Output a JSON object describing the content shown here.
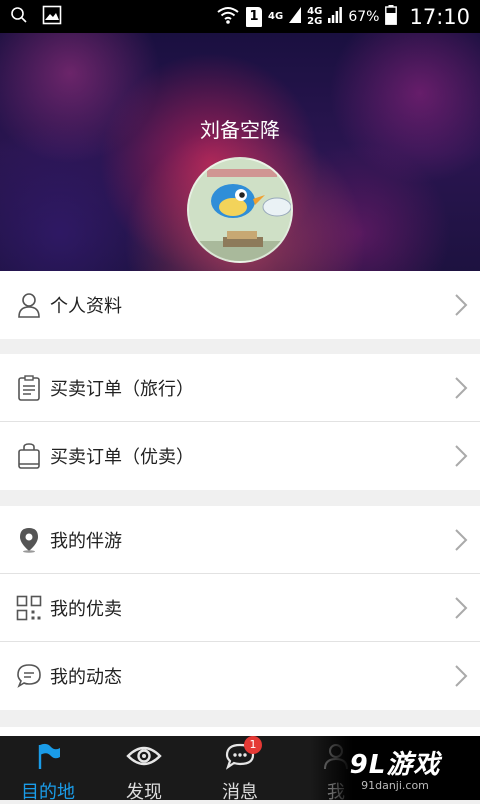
{
  "status_bar": {
    "network_a": "4G",
    "network_b_top": "4G",
    "network_b_bottom": "2G",
    "sim": "1",
    "battery": "67%",
    "time": "17:10"
  },
  "profile": {
    "username": "刘备空降"
  },
  "menu": {
    "group1": [
      {
        "label": "个人资料",
        "icon": "person-icon"
      }
    ],
    "group2": [
      {
        "label": "买卖订单（旅行）",
        "icon": "clipboard-icon"
      },
      {
        "label": "买卖订单（优卖）",
        "icon": "shopping-bag-icon"
      }
    ],
    "group3": [
      {
        "label": "我的伴游",
        "icon": "location-pin-icon"
      },
      {
        "label": "我的优卖",
        "icon": "grid-icon"
      },
      {
        "label": "我的动态",
        "icon": "chat-bubble-icon"
      }
    ]
  },
  "tabs": [
    {
      "label": "目的地",
      "icon": "flag-icon",
      "active": true
    },
    {
      "label": "发现",
      "icon": "eye-icon",
      "active": false
    },
    {
      "label": "消息",
      "icon": "message-icon",
      "active": false,
      "badge": "1"
    },
    {
      "label": "我",
      "icon": "person-icon",
      "active": false
    }
  ],
  "watermark": {
    "main": "9L游戏",
    "sub": "91danji.com"
  },
  "colors": {
    "accent": "#1a9ce8",
    "badge": "#e53935",
    "tabbar_bg": "#1a1a1a"
  }
}
